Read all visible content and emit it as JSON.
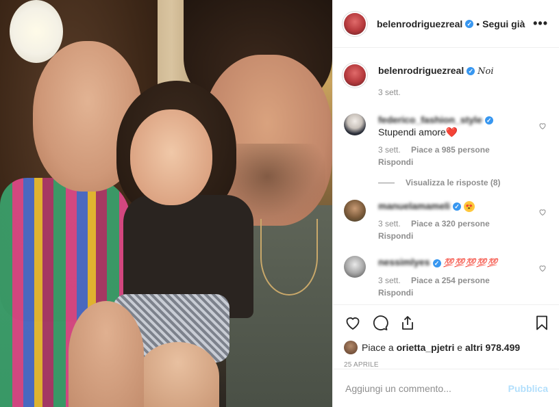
{
  "header": {
    "username": "belenrodriguezreal",
    "separator": "•",
    "follow_label": "Segui già",
    "more_label": "•••"
  },
  "caption": {
    "username": "belenrodriguezreal",
    "text": "𝑁𝑜𝑖",
    "time": "3 sett."
  },
  "comments": [
    {
      "username": "federico_fashion_style",
      "text": "Stupendi amore",
      "emoji": "❤️",
      "time": "3 sett.",
      "likes": "Piace a 985 persone",
      "reply": "Rispondi",
      "view_replies": "Visualizza le risposte (8)"
    },
    {
      "username": "manuelamameli",
      "text": "",
      "emoji": "😍",
      "time": "3 sett.",
      "likes": "Piace a 320 persone",
      "reply": "Rispondi"
    },
    {
      "username": "nessimlyes",
      "text": "",
      "emoji": "💯💯💯💯💯",
      "time": "3 sett.",
      "likes": "Piace a 254 persone",
      "reply": "Rispondi"
    }
  ],
  "likes_summary": {
    "prefix": "Piace a ",
    "user": "orietta_pjetri",
    "middle": " e ",
    "others": "altri 978.499"
  },
  "date": "25 APRILE",
  "comment_input": {
    "placeholder": "Aggiungi un commento...",
    "publish_label": "Pubblica"
  },
  "colors": {
    "verified": "#3897f0",
    "publish_disabled": "#b2dffc",
    "secondary_text": "#8e8e8e"
  }
}
